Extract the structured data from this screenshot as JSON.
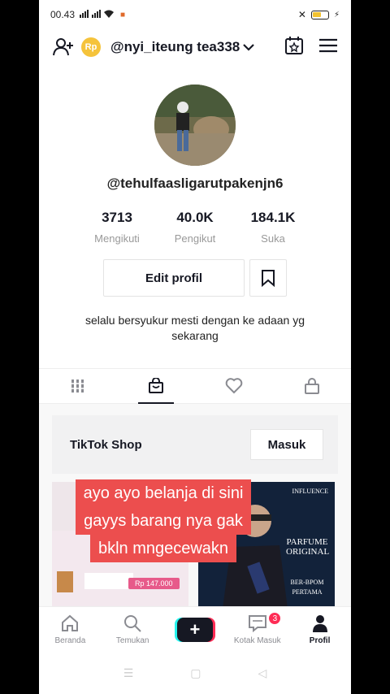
{
  "status_bar": {
    "time": "00.43",
    "network_icons": "signal-wifi-icons",
    "battery_icon": "battery-icon"
  },
  "header": {
    "coin_label": "Rp",
    "username": "@nyi_iteung tea338",
    "dropdown_icon": "chevron-down-icon"
  },
  "profile": {
    "handle": "@tehulfaasligarutpakenjn6",
    "stats": [
      {
        "value": "3713",
        "label": "Mengikuti"
      },
      {
        "value": "40.0K",
        "label": "Pengikut"
      },
      {
        "value": "184.1K",
        "label": "Suka"
      }
    ],
    "edit_label": "Edit profil",
    "bio": "selalu bersyukur mesti dengan ke adaan yg sekarang"
  },
  "tabs": [
    {
      "icon": "grid-icon"
    },
    {
      "icon": "shopping-bag-icon",
      "active": true
    },
    {
      "icon": "heart-icon"
    },
    {
      "icon": "lock-icon"
    }
  ],
  "shop": {
    "title": "TikTok Shop",
    "button_label": "Masuk",
    "price_tag": "Rp 147.000",
    "thumb2_brand": "INFLUENCE",
    "thumb2_title": "PARFUME ORIGINAL",
    "thumb2_sub": "BER-BPOM PERTAMA"
  },
  "caption": {
    "lines": [
      "ayo ayo belanja di sini",
      "gayys barang nya gak",
      "bkln mngecewakn"
    ]
  },
  "bottom_nav": [
    {
      "label": "Beranda",
      "icon": "home-icon"
    },
    {
      "label": "Temukan",
      "icon": "search-icon"
    },
    {
      "label": "",
      "icon": "plus-icon"
    },
    {
      "label": "Kotak Masuk",
      "icon": "inbox-icon",
      "badge": "3"
    },
    {
      "label": "Profil",
      "icon": "profile-icon",
      "active": true
    }
  ],
  "colors": {
    "accent": "#fe2c55",
    "cyan": "#25f4ee",
    "caption_bg": "#ec4e4e"
  }
}
